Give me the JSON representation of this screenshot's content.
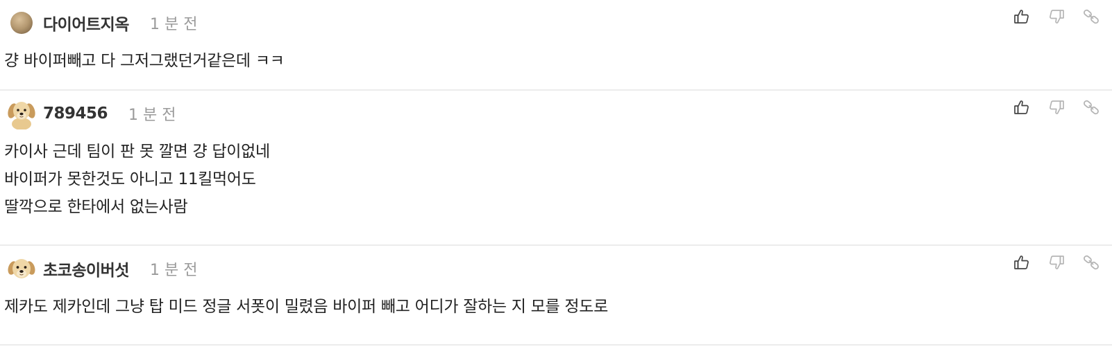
{
  "comments": [
    {
      "username": "다이어트지옥",
      "time": "1 분 전",
      "avatar": "bronze-circle-avatar",
      "lines": [
        "걍 바이퍼빼고 다 그저그랬던거같은데 ㅋㅋ"
      ]
    },
    {
      "username": "789456",
      "time": "1 분 전",
      "avatar": "puppy-avatar",
      "lines": [
        "카이사 근데 팀이 판 못 깔면 걍 답이없네",
        "바이퍼가 못한것도 아니고 11킬먹어도",
        "딸깍으로 한타에서 없는사람"
      ]
    },
    {
      "username": "초코송이버섯",
      "time": "1 분 전",
      "avatar": "puppy-avatar",
      "lines": [
        "제카도 제카인데 그냥 탑 미드 정글 서폿이 밀렸음 바이퍼 빼고 어디가 잘하는 지 모를 정도로"
      ]
    }
  ],
  "actions": {
    "like_icon": "thumbs-up-icon",
    "dislike_icon": "thumbs-down-icon",
    "link_icon": "link-icon",
    "like_color": "#444444",
    "dislike_color": "#b5b5b5",
    "link_color": "#b5b5b5"
  },
  "colors": {
    "username": "#333333",
    "time": "#9a9a9a",
    "text": "#222222",
    "divider": "#ececec"
  }
}
